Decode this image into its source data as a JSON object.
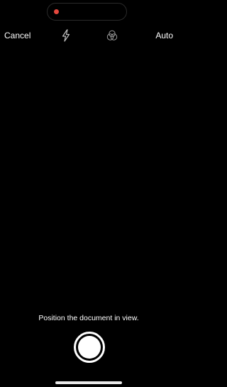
{
  "status": {
    "recording_color": "#e5483e"
  },
  "toolbar": {
    "cancel_label": "Cancel",
    "flash_icon": "flash-icon",
    "filter_icon": "filters-icon",
    "mode_label": "Auto"
  },
  "camera": {
    "hint": "Position the document in view."
  },
  "controls": {
    "shutter_icon": "shutter-button"
  }
}
